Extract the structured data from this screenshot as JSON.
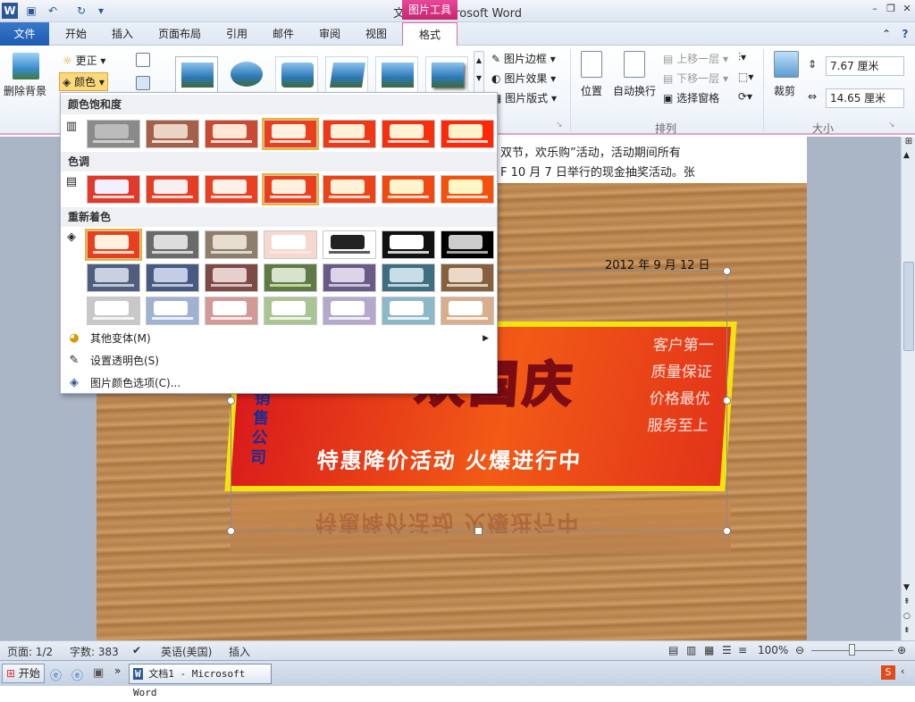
{
  "titlebar": {
    "title": "文档1 - Microsoft Word",
    "context_tab": "图片工具"
  },
  "tabs": [
    {
      "label": "文件"
    },
    {
      "label": "开始"
    },
    {
      "label": "插入"
    },
    {
      "label": "页面布局"
    },
    {
      "label": "引用"
    },
    {
      "label": "邮件"
    },
    {
      "label": "审阅"
    },
    {
      "label": "视图"
    },
    {
      "label": "格式"
    }
  ],
  "ribbon": {
    "remove_bg": "删除背景",
    "correct": "更正",
    "color": "颜色",
    "picture_border": "图片边框",
    "picture_effects": "图片效果",
    "picture_layout": "图片版式",
    "position": "位置",
    "wrap": "自动换行",
    "bring_forward": "上移一层",
    "send_backward": "下移一层",
    "selection_pane": "选择窗格",
    "arrange_label": "排列",
    "crop": "裁剪",
    "height": "7.67 厘米",
    "width": "14.65 厘米",
    "size_label": "大小"
  },
  "dropdown": {
    "saturation_title": "颜色饱和度",
    "tone_title": "色调",
    "recolor_title": "重新着色",
    "more_variations": "其他变体(M)",
    "set_transparent": "设置透明色(S)",
    "color_options": "图片颜色选项(C)..."
  },
  "document": {
    "line1": "双节，欢乐购”活动，活动期间所有",
    "line2": "F 10 月 7 日举行的现金抽奖活动。张",
    "date": "2012 年 9 月 12 日",
    "poster_big": "欢国庆",
    "poster_mid": "特惠降价活动  火爆进行中",
    "poster_side": [
      "客户第一",
      "质量保证",
      "价格最优",
      "服务至上"
    ],
    "poster_left": "销售公司"
  },
  "status": {
    "page": "页面: 1/2",
    "words": "字数: 383",
    "lang": "英语(美国)",
    "mode": "插入",
    "zoom": "100%"
  },
  "taskbar": {
    "start": "开始",
    "task": "文档1 - Microsoft Word"
  },
  "colors": {
    "accent_pink": "#c9236d",
    "file_blue": "#1d5bb3"
  }
}
